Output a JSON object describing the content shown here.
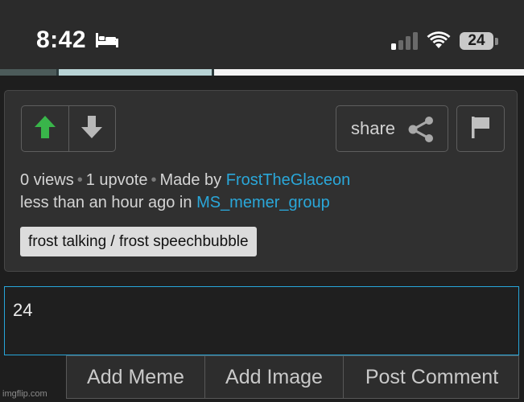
{
  "status_bar": {
    "time": "8:42",
    "focus_icon": "bed-icon",
    "signal_icon": "cellular-signal-icon",
    "wifi_icon": "wifi-icon",
    "battery": "24"
  },
  "post": {
    "upvote_icon": "arrow-up-icon",
    "downvote_icon": "arrow-down-icon",
    "share_label": "share",
    "share_icon": "share-icon",
    "flag_icon": "flag-icon",
    "views": "0 views",
    "upvotes": "1 upvote",
    "made_by_prefix": "Made by",
    "author": "FrostTheGlaceon",
    "time_prefix": "less than an hour ago in",
    "group": "MS_memer_group",
    "tag": "frost talking / frost speechbubble"
  },
  "comment": {
    "value": "24"
  },
  "actions": {
    "add_meme": "Add Meme",
    "add_image": "Add Image",
    "post_comment": "Post Comment"
  },
  "watermark": "imgflip.com",
  "colors": {
    "accent": "#2aa7d9",
    "upvote_active": "#39b54a",
    "background": "#1e1e1e",
    "card": "#303030"
  }
}
